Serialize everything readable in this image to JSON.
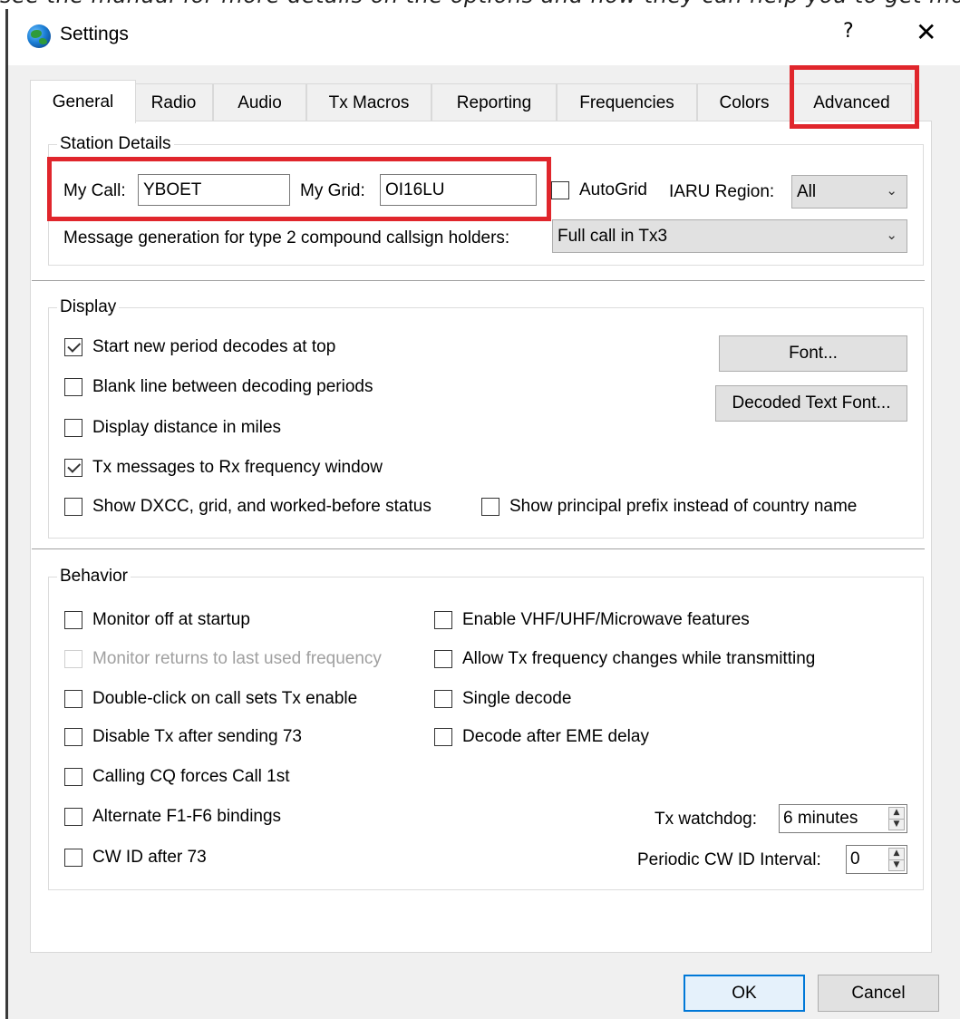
{
  "top_cropped_text": "see the manual for more details on the options and how they can help you to get more from the software",
  "window": {
    "title": "Settings",
    "icon": "globe-icon",
    "help_glyph": "?",
    "close_glyph": "✕"
  },
  "tabs": [
    {
      "label": "General",
      "active": true
    },
    {
      "label": "Radio",
      "active": false
    },
    {
      "label": "Audio",
      "active": false
    },
    {
      "label": "Tx Macros",
      "active": false
    },
    {
      "label": "Reporting",
      "active": false
    },
    {
      "label": "Frequencies",
      "active": false
    },
    {
      "label": "Colors",
      "active": false
    },
    {
      "label": "Advanced",
      "active": false
    }
  ],
  "station": {
    "group_title": "Station Details",
    "mycall_label": "My Call:",
    "mycall_value": "YBOET",
    "mygrid_label": "My Grid:",
    "mygrid_value": "OI16LU",
    "autogrid_label": "AutoGrid",
    "autogrid_checked": false,
    "iaru_label": "IARU Region:",
    "iaru_value": "All",
    "msg_gen_label": "Message generation for type 2 compound callsign holders:",
    "msg_gen_value": "Full call in Tx3"
  },
  "display": {
    "group_title": "Display",
    "start_new_period": {
      "label": "Start new period decodes at top",
      "checked": true
    },
    "blank_line": {
      "label": "Blank line between decoding periods",
      "checked": false
    },
    "distance_miles": {
      "label": "Display distance in miles",
      "checked": false
    },
    "tx_messages": {
      "label": "Tx messages to Rx frequency window",
      "checked": true
    },
    "show_dxcc": {
      "label": "Show DXCC, grid, and worked-before status",
      "checked": false
    },
    "show_prefix": {
      "label": "Show principal prefix instead of country name",
      "checked": false
    },
    "font_button": "Font...",
    "decoded_font_button": "Decoded Text Font..."
  },
  "behavior": {
    "group_title": "Behavior",
    "monitor_off": {
      "label": "Monitor off at startup",
      "checked": false
    },
    "monitor_returns": {
      "label": "Monitor returns to last used frequency",
      "checked": false,
      "disabled": true
    },
    "double_click": {
      "label": "Double-click on call sets Tx enable",
      "checked": false
    },
    "disable_tx": {
      "label": "Disable Tx after sending 73",
      "checked": false
    },
    "calling_cq": {
      "label": "Calling CQ forces Call 1st",
      "checked": false
    },
    "alternate_f1": {
      "label": "Alternate F1-F6 bindings",
      "checked": false
    },
    "cw_id": {
      "label": "CW ID after 73",
      "checked": false
    },
    "enable_vhf": {
      "label": "Enable VHF/UHF/Microwave features",
      "checked": false
    },
    "allow_tx_freq": {
      "label": "Allow Tx frequency changes while transmitting",
      "checked": false
    },
    "single_decode": {
      "label": "Single decode",
      "checked": false
    },
    "decode_eme": {
      "label": "Decode after EME delay",
      "checked": false
    },
    "tx_watchdog_label": "Tx watchdog:",
    "tx_watchdog_value": "6 minutes",
    "periodic_cw_label": "Periodic CW ID Interval:",
    "periodic_cw_value": "0"
  },
  "footer": {
    "ok_label": "OK",
    "cancel_label": "Cancel"
  },
  "annotation_color": "#e0262c",
  "accent_color": "#0078d7"
}
